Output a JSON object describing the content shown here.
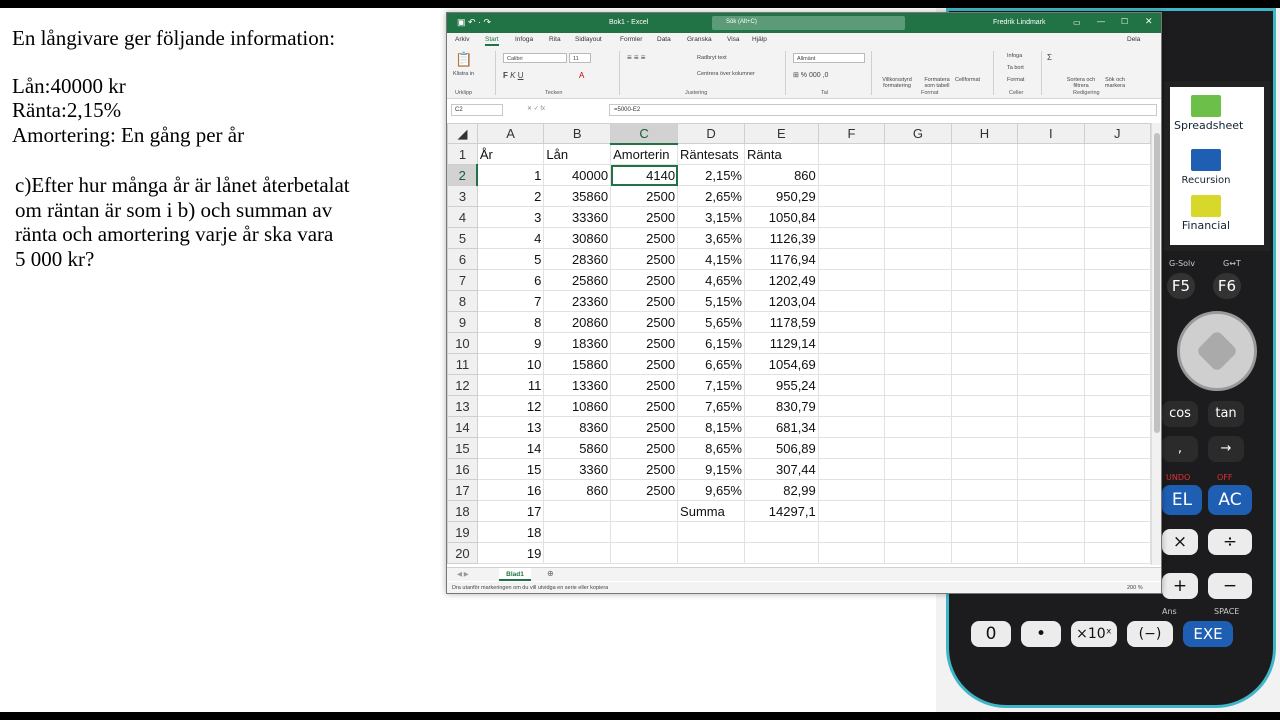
{
  "problem": {
    "intro": "En långivare ger följande information:",
    "loan": "Lån:40000 kr",
    "rate": "Ränta:2,15%",
    "amortization": "Amortering: En gång per år",
    "question_lines": [
      "c)Efter hur många år är lånet återbetalat",
      "om räntan är som i b) och summan av",
      "ränta och amortering varje år ska vara",
      "5 000 kr?"
    ]
  },
  "excel": {
    "title": "Bok1  -  Excel",
    "search_placeholder": "Sök (Alt+C)",
    "user": "Fredrik Lindmark",
    "share": "Dela",
    "menu_tabs": [
      "Arkiv",
      "Start",
      "Infoga",
      "Rita",
      "Sidlayout",
      "Formler",
      "Data",
      "Granska",
      "Visa",
      "Hjälp"
    ],
    "active_tab": "Start",
    "ribbon": {
      "paste": "Klistra in",
      "font": "Calibri",
      "font_size": "11",
      "wrap": "Radbryt text",
      "merge": "Centrera över kolumner",
      "number_format": "Allmänt",
      "cond_format": "Villkorsstyrd formatering",
      "format_table": "Formatera som tabell",
      "cell_styles": "Cellformat",
      "insert": "Infoga",
      "delete": "Ta bort",
      "format": "Format",
      "sort": "Sortera och filtrera",
      "find": "Sök och markera",
      "groups": [
        "Urklipp",
        "Tecken",
        "Justering",
        "Tal",
        "Format",
        "Celler",
        "Redigering"
      ]
    },
    "name_box": "C2",
    "formula": "=5000-E2",
    "column_headers": [
      "A",
      "B",
      "C",
      "D",
      "E",
      "F",
      "G",
      "H",
      "I",
      "J"
    ],
    "rows": [
      {
        "n": "1",
        "cells": [
          "År",
          "Lån",
          "Amorterin",
          "Räntesats",
          "Ränta",
          "",
          "",
          "",
          "",
          ""
        ]
      },
      {
        "n": "2",
        "cells": [
          "1",
          "40000",
          "4140",
          "2,15%",
          "860",
          "",
          "",
          "",
          "",
          ""
        ]
      },
      {
        "n": "3",
        "cells": [
          "2",
          "35860",
          "2500",
          "2,65%",
          "950,29",
          "",
          "",
          "",
          "",
          ""
        ]
      },
      {
        "n": "4",
        "cells": [
          "3",
          "33360",
          "2500",
          "3,15%",
          "1050,84",
          "",
          "",
          "",
          "",
          ""
        ]
      },
      {
        "n": "5",
        "cells": [
          "4",
          "30860",
          "2500",
          "3,65%",
          "1126,39",
          "",
          "",
          "",
          "",
          ""
        ]
      },
      {
        "n": "6",
        "cells": [
          "5",
          "28360",
          "2500",
          "4,15%",
          "1176,94",
          "",
          "",
          "",
          "",
          ""
        ]
      },
      {
        "n": "7",
        "cells": [
          "6",
          "25860",
          "2500",
          "4,65%",
          "1202,49",
          "",
          "",
          "",
          "",
          ""
        ]
      },
      {
        "n": "8",
        "cells": [
          "7",
          "23360",
          "2500",
          "5,15%",
          "1203,04",
          "",
          "",
          "",
          "",
          ""
        ]
      },
      {
        "n": "9",
        "cells": [
          "8",
          "20860",
          "2500",
          "5,65%",
          "1178,59",
          "",
          "",
          "",
          "",
          ""
        ]
      },
      {
        "n": "10",
        "cells": [
          "9",
          "18360",
          "2500",
          "6,15%",
          "1129,14",
          "",
          "",
          "",
          "",
          ""
        ]
      },
      {
        "n": "11",
        "cells": [
          "10",
          "15860",
          "2500",
          "6,65%",
          "1054,69",
          "",
          "",
          "",
          "",
          ""
        ]
      },
      {
        "n": "12",
        "cells": [
          "11",
          "13360",
          "2500",
          "7,15%",
          "955,24",
          "",
          "",
          "",
          "",
          ""
        ]
      },
      {
        "n": "13",
        "cells": [
          "12",
          "10860",
          "2500",
          "7,65%",
          "830,79",
          "",
          "",
          "",
          "",
          ""
        ]
      },
      {
        "n": "14",
        "cells": [
          "13",
          "8360",
          "2500",
          "8,15%",
          "681,34",
          "",
          "",
          "",
          "",
          ""
        ]
      },
      {
        "n": "15",
        "cells": [
          "14",
          "5860",
          "2500",
          "8,65%",
          "506,89",
          "",
          "",
          "",
          "",
          ""
        ]
      },
      {
        "n": "16",
        "cells": [
          "15",
          "3360",
          "2500",
          "9,15%",
          "307,44",
          "",
          "",
          "",
          "",
          ""
        ]
      },
      {
        "n": "17",
        "cells": [
          "16",
          "860",
          "2500",
          "9,65%",
          "82,99",
          "",
          "",
          "",
          "",
          ""
        ]
      },
      {
        "n": "18",
        "cells": [
          "17",
          "",
          "",
          "Summa",
          "14297,1",
          "",
          "",
          "",
          "",
          ""
        ]
      },
      {
        "n": "19",
        "cells": [
          "18",
          "",
          "",
          "",
          "",
          "",
          "",
          "",
          "",
          ""
        ]
      },
      {
        "n": "20",
        "cells": [
          "19",
          "",
          "",
          "",
          "",
          "",
          "",
          "",
          "",
          ""
        ]
      }
    ],
    "sheet_tab": "Blad1",
    "status": "Dra utanför markeringen om du vill utvidga en serie eller kopiera",
    "zoom": "200 %"
  },
  "calculator": {
    "menu": [
      "Spreadsheet",
      "an=\nAn+B Recursion",
      "Financial"
    ],
    "labels": {
      "gsolv": "G-Solv",
      "gt": "G↔T",
      "f5": "F5",
      "f6": "F6",
      "cos": "cos",
      "tan": "tan",
      "comma": ",",
      "arrow": "→",
      "del": "EL",
      "ac": "AC",
      "undo": "UNDO",
      "off": "OFF",
      "times": "×",
      "div": "÷",
      "plus": "+",
      "minus": "−",
      "zero": "0",
      "dot": "•",
      "exp": "×10ˣ",
      "neg": "(−)",
      "exe": "EXE",
      "space": "SPACE",
      "ans": "Ans"
    }
  },
  "colors": {
    "excel_green": "#217346",
    "calc_rim": "#3fb6c8"
  }
}
